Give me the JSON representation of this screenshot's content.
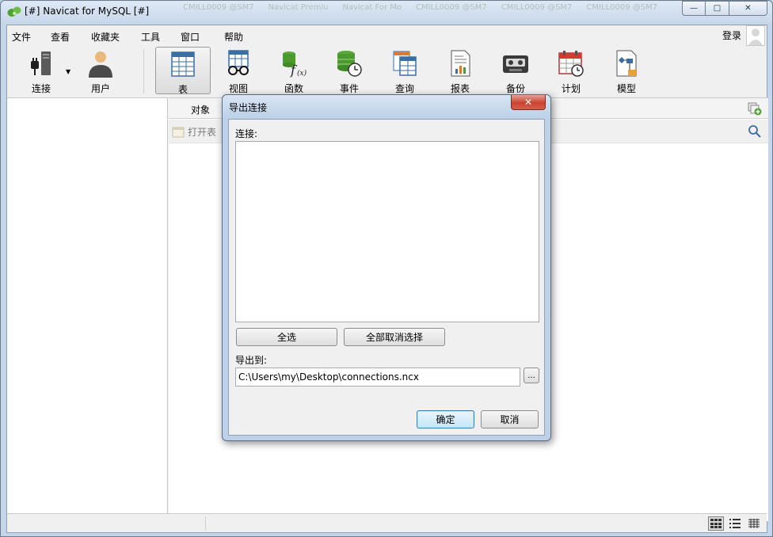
{
  "window": {
    "title": "[#] Navicat for MySQL [#]",
    "ghost_tabs": [
      "CMILL0009 @SM7",
      "Navicat Premiu",
      "Navicat For Mo",
      "CMILL0009 @SM7",
      "CMILL0009 @SM7",
      "CMILL0009 @SM7"
    ],
    "controls": {
      "minimize": "—",
      "maximize": "□",
      "close": "✕"
    }
  },
  "menu": {
    "items": [
      "文件",
      "查看",
      "收藏夹",
      "工具",
      "窗口",
      "帮助"
    ],
    "login": "登录"
  },
  "toolbar": {
    "connect": "连接",
    "user": "用户",
    "items": [
      {
        "key": "table",
        "label": "表",
        "icon": "table-icon",
        "active": true
      },
      {
        "key": "view",
        "label": "视图",
        "icon": "view-glasses-icon"
      },
      {
        "key": "function",
        "label": "函数",
        "icon": "function-icon"
      },
      {
        "key": "event",
        "label": "事件",
        "icon": "event-clock-icon"
      },
      {
        "key": "query",
        "label": "查询",
        "icon": "query-icon"
      },
      {
        "key": "report",
        "label": "报表",
        "icon": "report-icon"
      },
      {
        "key": "backup",
        "label": "备份",
        "icon": "backup-tape-icon"
      },
      {
        "key": "schedule",
        "label": "计划",
        "icon": "calendar-icon"
      },
      {
        "key": "model",
        "label": "模型",
        "icon": "model-icon"
      }
    ]
  },
  "objects": {
    "tab": "对象",
    "open_table": "打开表"
  },
  "dialog": {
    "title": "导出连接",
    "close": "✕",
    "connections_label": "连接:",
    "select_all": "全选",
    "deselect_all": "全部取消选择",
    "export_to_label": "导出到:",
    "export_path": "C:\\Users\\my\\Desktop\\connections.ncx",
    "browse": "...",
    "ok": "确定",
    "cancel": "取消"
  },
  "colors": {
    "title_bar": "#c6d6ea",
    "accent_green": "#4aa32e",
    "dialog_close_red": "#c9432f"
  }
}
